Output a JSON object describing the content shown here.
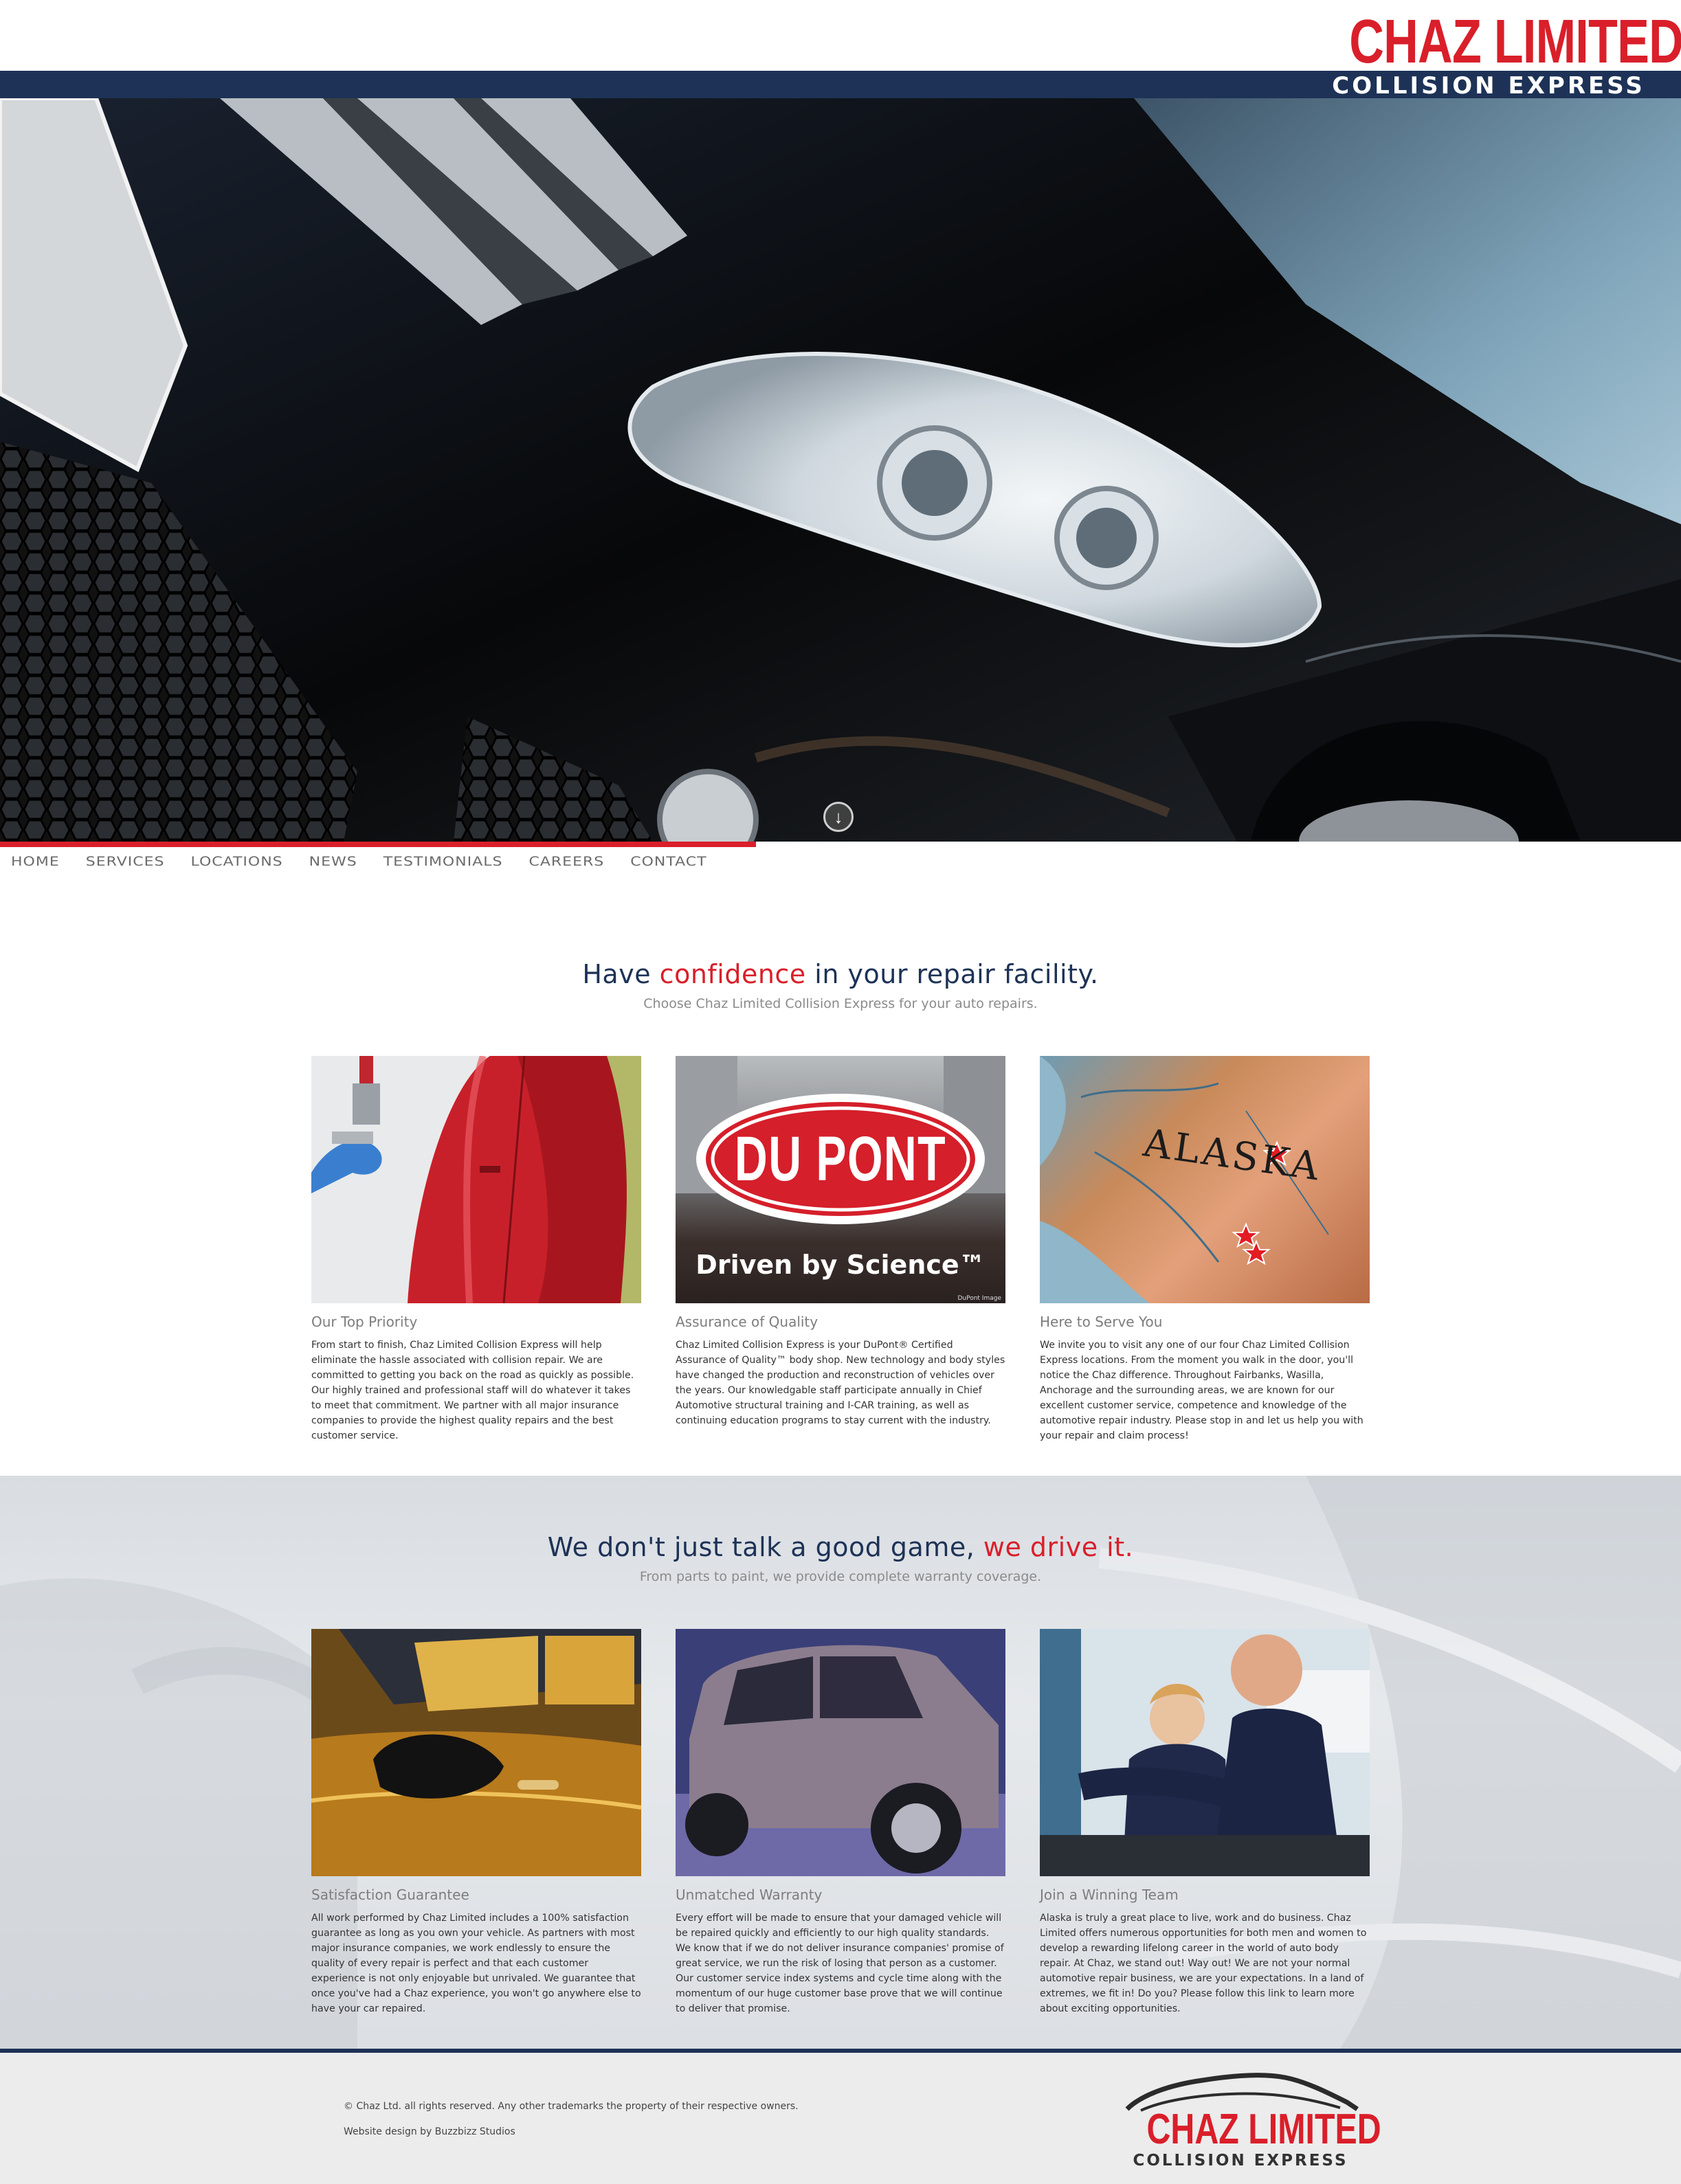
{
  "brand": {
    "name_line1": "CHAZ LIMITED",
    "name_line2": "COLLISION EXPRESS",
    "red": "#d91f2a",
    "navy": "#1d3256"
  },
  "hero": {
    "scroll_icon": "chevron-down-circle-icon"
  },
  "nav": {
    "items": [
      "HOME",
      "SERVICES",
      "LOCATIONS",
      "NEWS",
      "TESTIMONIALS",
      "CAREERS",
      "CONTACT"
    ]
  },
  "section1": {
    "title_pre": "Have ",
    "title_accent": "confidence",
    "title_post": " in your repair facility.",
    "subtitle": "Choose Chaz Limited Collision Express for your auto repairs.",
    "cards": [
      {
        "title": "Our Top Priority",
        "text": "From start to finish, Chaz Limited Collision Express will help eliminate the hassle associated with collision repair. We are committed to getting you back on the road as quickly as possible. Our highly trained and professional staff will do whatever it takes to meet that commitment. We partner with all major insurance companies to provide the highest quality repairs and the best customer service."
      },
      {
        "title": "Assurance of Quality",
        "text": "Chaz Limited Collision Express is your DuPont® Certified Assurance of Quality™ body shop. New technology and body styles have changed the production and reconstruction of vehicles over the years. Our knowledgable staff participate annually in Chief Automotive structural training and I-CAR training, as well as continuing education programs to stay current with the industry.",
        "image_logo": "DU PONT",
        "image_tagline": "Driven by Science™",
        "image_credit": "DuPont Image"
      },
      {
        "title": "Here to Serve You",
        "text": "We invite you to visit any one of our four Chaz Limited Collision Express locations. From the moment you walk in the door, you'll notice the Chaz difference. Throughout Fairbanks, Wasilla, Anchorage and the surrounding areas, we are known for our excellent customer service, competence and knowledge of the automotive repair industry. Please stop in and let us help you with your repair and claim process!",
        "map_label": "ALASKA"
      }
    ]
  },
  "section2": {
    "title_pre": "We don't just talk a good game, ",
    "title_accent": "we drive it.",
    "subtitle": "From parts to paint, we provide complete warranty coverage.",
    "cards": [
      {
        "title": "Satisfaction Guarantee",
        "text": "All work performed by Chaz Limited includes a 100% satisfaction guarantee as long as you own your vehicle. As partners with most major insurance companies, we work endlessly to ensure the quality of every repair is perfect and that each customer experience is not only enjoyable but unrivaled. We guarantee that once you've had a Chaz experience, you won't go anywhere else to have your car repaired."
      },
      {
        "title": "Unmatched Warranty",
        "text": "Every effort will be made to ensure that your damaged vehicle will be repaired quickly and efficiently to our high quality standards. We know that if we do not deliver insurance companies' promise of great service, we run the risk of losing that person as a customer. Our customer service index systems and cycle time along with the momentum of our huge customer base prove that we will continue to deliver that promise."
      },
      {
        "title": "Join a Winning Team",
        "text": "Alaska is truly a great place to live, work and do business. Chaz Limited offers numerous opportunities for both men and women to develop a rewarding lifelong career in the world of auto body repair. At Chaz, we stand out! Way out! We are not your normal automotive repair business, we are your expectations. In a land of extremes, we fit in! Do you? Please follow this link to learn more about exciting opportunities."
      }
    ]
  },
  "footer": {
    "copyright": "© Chaz Ltd. all rights reserved. Any other trademarks the property of their respective owners.",
    "credit": "Website design by Buzzbizz Studios"
  }
}
